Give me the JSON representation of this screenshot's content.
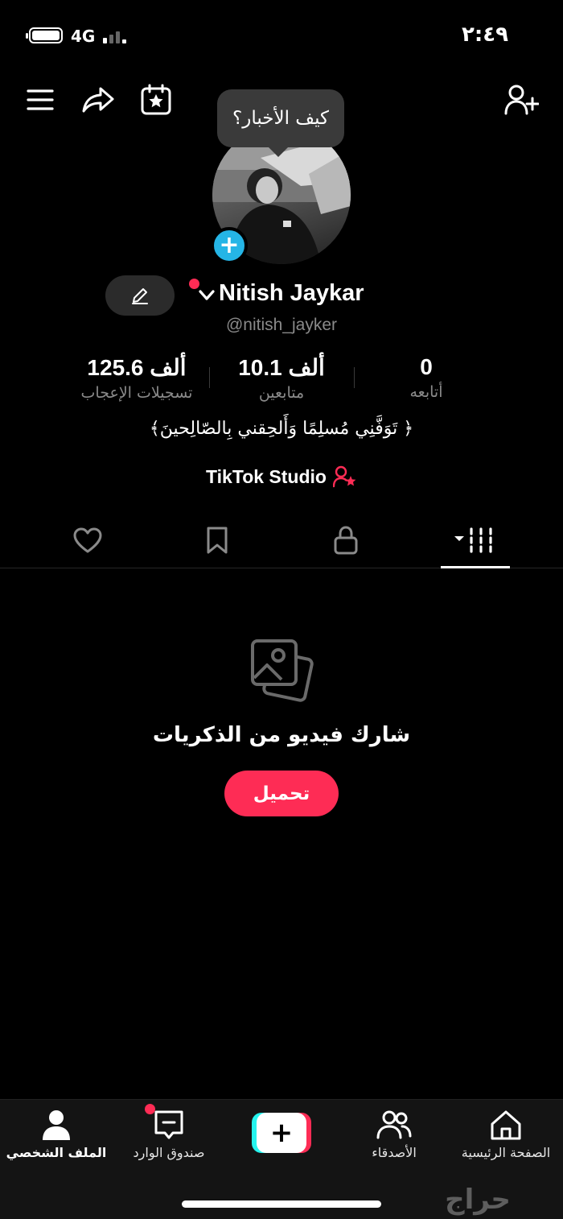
{
  "status_bar": {
    "network": "4G",
    "time": "٢:٤٩"
  },
  "tooltip": {
    "text": "كيف الأخبار؟"
  },
  "profile": {
    "name": "Nitish Jaykar",
    "handle": "@nitish_jayker",
    "bio": "﴿ تَوَفَّنِي مُسلِمًا وَأَلحِقني بِالصّالِحينَ﴾",
    "studio_label": "TikTok Studio"
  },
  "stats": [
    {
      "value": "0",
      "label": "أتابعه"
    },
    {
      "value": "10.1 ألف",
      "label": "متابعين"
    },
    {
      "value": "125.6 ألف",
      "label": "تسجيلات الإعجاب"
    }
  ],
  "tabs": [
    "videos-grid",
    "private-lock",
    "saved-bookmark",
    "liked-heart"
  ],
  "empty_state": {
    "title": "شارك فيديو من الذكريات",
    "button": "تحميل"
  },
  "bottom_nav": {
    "home": "الصفحة الرئيسية",
    "friends": "الأصدقاء",
    "inbox": "صندوق الوارد",
    "profile": "الملف الشخصي"
  },
  "watermark": "حراج",
  "colors": {
    "accent": "#fe2c55",
    "cyan": "#25f4ee",
    "blue_plus": "#25b5e6"
  }
}
